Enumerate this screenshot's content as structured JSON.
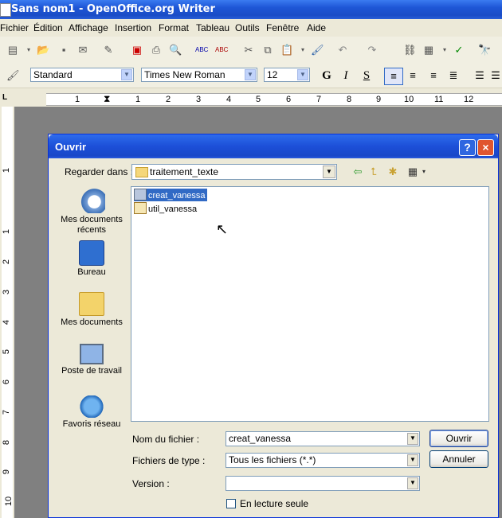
{
  "window": {
    "title": "Sans nom1 - OpenOffice.org Writer"
  },
  "menu": [
    "Fichier",
    "Édition",
    "Affichage",
    "Insertion",
    "Format",
    "Tableau",
    "Outils",
    "Fenêtre",
    "Aide"
  ],
  "format_bar": {
    "style": "Standard",
    "font": "Times New Roman",
    "size": "12"
  },
  "ruler": {
    "numbers": [
      "1",
      "1",
      "2",
      "3",
      "4",
      "5",
      "6",
      "7",
      "8",
      "9",
      "10",
      "11",
      "12"
    ]
  },
  "vruler": {
    "numbers": [
      "1",
      "1",
      "2",
      "3",
      "4",
      "5",
      "6",
      "7",
      "8",
      "9",
      "10"
    ]
  },
  "dialog": {
    "title": "Ouvrir",
    "help": "?",
    "close": "×",
    "look_in_label": "Regarder dans :",
    "look_in_value": "traitement_texte",
    "places": [
      {
        "label": "Mes documents récents"
      },
      {
        "label": "Bureau"
      },
      {
        "label": "Mes documents"
      },
      {
        "label": "Poste de travail"
      },
      {
        "label": "Favoris réseau"
      }
    ],
    "files": [
      {
        "name": "creat_vanessa",
        "selected": true
      },
      {
        "name": "util_vanessa",
        "selected": false
      }
    ],
    "filename_label": "Nom du fichier :",
    "filename_value": "creat_vanessa",
    "filetype_label": "Fichiers de type :",
    "filetype_value": "Tous les fichiers (*.*)",
    "version_label": "Version :",
    "version_value": "",
    "readonly_label": "En lecture seule",
    "open_button": "Ouvrir",
    "cancel_button": "Annuler"
  },
  "colors": {
    "titlebar": "#1e56d6",
    "selection": "#316ac5"
  }
}
